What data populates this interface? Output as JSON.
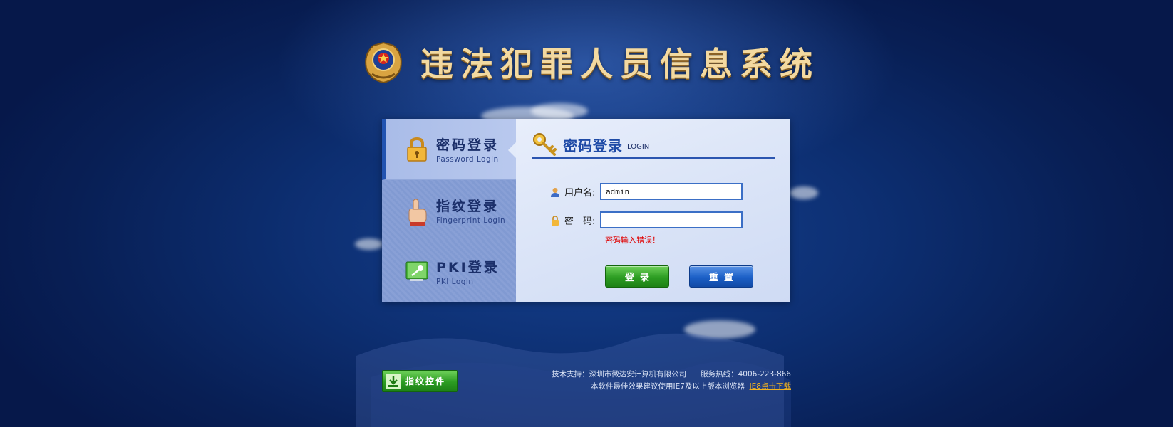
{
  "header": {
    "title": "违法犯罪人员信息系统"
  },
  "sidebar": {
    "items": [
      {
        "label": "密码登录",
        "sublabel": "Password Login",
        "icon": "padlock-icon",
        "active": true
      },
      {
        "label": "指纹登录",
        "sublabel": "Fingerprint Login",
        "icon": "pointing-hand-icon",
        "active": false
      },
      {
        "label": "PKI登录",
        "sublabel": "PKI Login",
        "icon": "pki-key-icon",
        "active": false
      }
    ]
  },
  "form": {
    "heading": "密码登录",
    "heading_en": "LOGIN",
    "username_label": "用户名:",
    "username_value": "admin",
    "password_label": "密　码:",
    "password_value": "",
    "error": "密码输入错误！",
    "login_button": "登录",
    "reset_button": "重置"
  },
  "footer": {
    "fingerprint_button": "指纹控件",
    "support": "技术支持：深圳市微达安计算机有限公司",
    "hotline": "服务热线：4006-223-866",
    "browser_note": "本软件最佳效果建议使用IE7及以上版本浏览器",
    "ie8_link": "IE8点击下载"
  },
  "colors": {
    "accent": "#2153b0",
    "error": "#e00000",
    "title": "#f3d9a0",
    "link": "#f2b321"
  }
}
